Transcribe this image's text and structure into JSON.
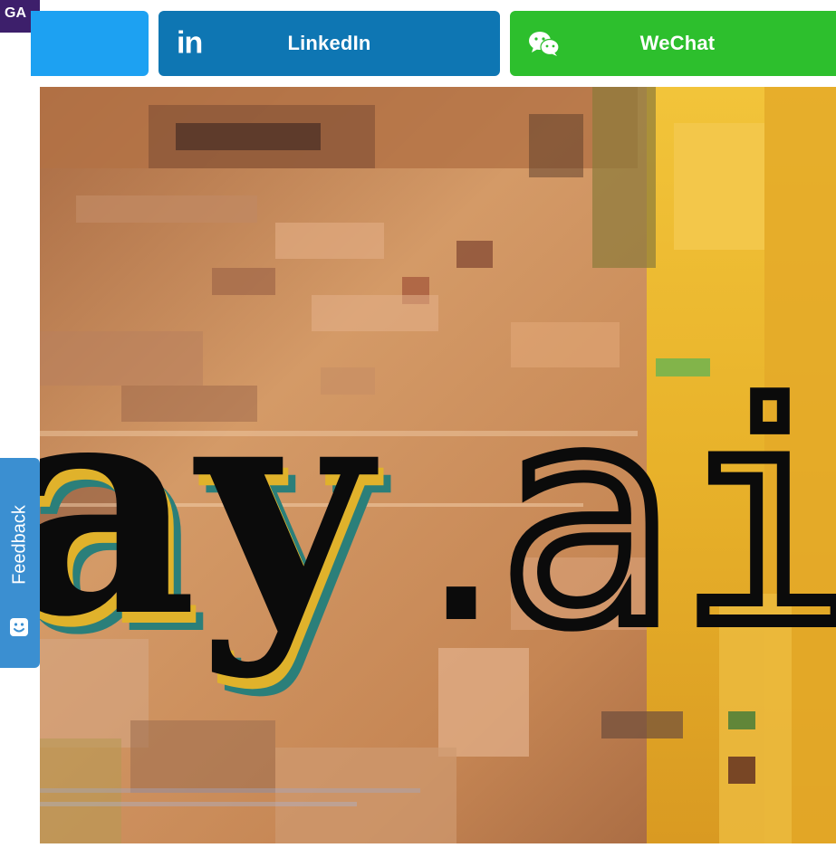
{
  "corner_badge": {
    "text": "GA"
  },
  "share_buttons": {
    "linkedin": {
      "label": "LinkedIn",
      "icon": "linkedin-icon",
      "icon_text": "in",
      "color": "#0e76b3"
    },
    "wechat": {
      "label": "WeChat",
      "icon": "wechat-icon",
      "color": "#2dbf2d"
    },
    "twitter": {
      "label": "",
      "icon": "twitter-icon",
      "color": "#1da1f2"
    }
  },
  "hero": {
    "wordmark_left": "ay",
    "wordmark_dot": ".",
    "wordmark_right": "ai"
  },
  "feedback": {
    "label": "Feedback",
    "icon": "smiley-icon",
    "color": "#3b8fd1"
  }
}
